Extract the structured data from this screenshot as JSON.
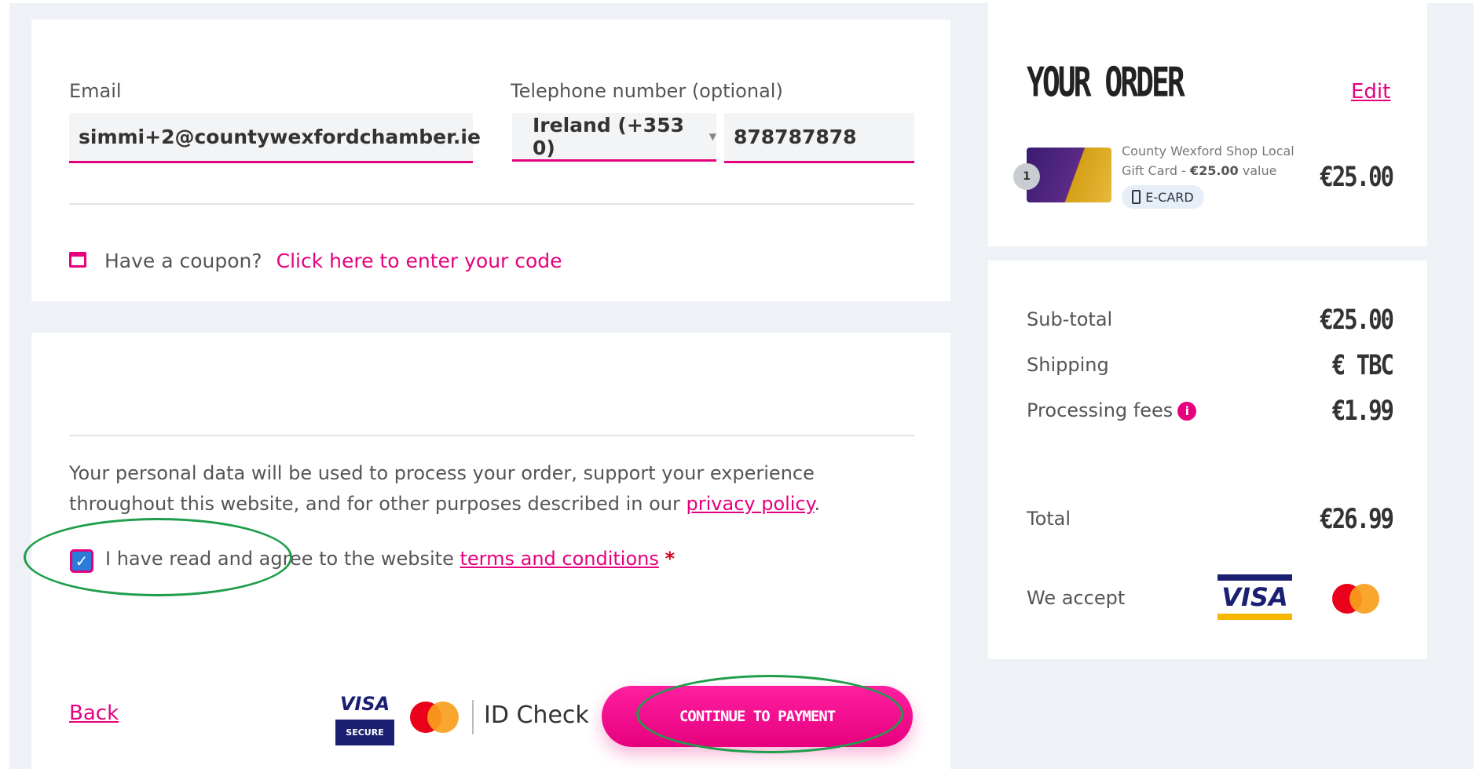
{
  "contact": {
    "email_label": "Email",
    "email_value": "simmi+2@countywexfordchamber.ie",
    "phone_label": "Telephone number (optional)",
    "country_code": "Ireland (+353 0)",
    "phone_value": "878787878",
    "coupon_prompt": "Have a coupon?",
    "coupon_link": "Click here to enter your code"
  },
  "terms": {
    "privacy_text_1": "Your personal data will be used to process your order, support your experience",
    "privacy_text_2": "throughout this website, and for other purposes described in our",
    "privacy_link": "privacy policy",
    "privacy_end": ".",
    "agree_text": "I have read and agree to the website",
    "terms_link": "terms and conditions",
    "required_mark": "*",
    "checked": true
  },
  "actions": {
    "back_label": "Back",
    "visa_secure_top": "VISA",
    "visa_secure_bottom": "SECURE",
    "id_check": "ID Check",
    "continue_label": "CONTINUE TO PAYMENT"
  },
  "order": {
    "title": "YOUR ORDER",
    "edit_label": "Edit",
    "item_line1": "County Wexford Shop Local",
    "item_line2_prefix": "Gift Card - ",
    "item_line2_value": "€25.00",
    "item_line2_suffix": " value",
    "item_badge": "E-CARD",
    "item_qty": "1",
    "item_price": "€25.00"
  },
  "totals": {
    "subtotal_label": "Sub-total",
    "subtotal_value": "€25.00",
    "shipping_label": "Shipping",
    "shipping_value": "€ TBC",
    "fees_label": "Processing fees",
    "fees_value": "€1.99",
    "total_label": "Total",
    "total_value": "€26.99",
    "accept_label": "We accept",
    "visa_text": "VISA"
  },
  "colors": {
    "accent": "#e6007e",
    "annotation": "#1e9e4a",
    "visa_blue": "#1a1f71"
  }
}
